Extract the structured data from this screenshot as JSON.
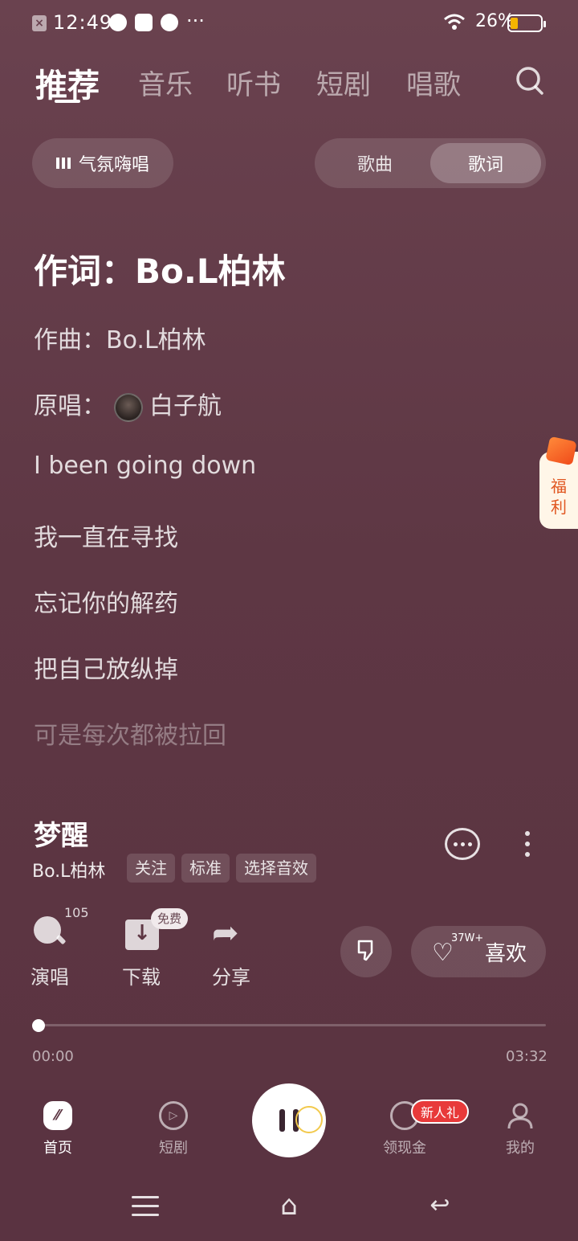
{
  "status_bar": {
    "time": "12:49",
    "dots": "···",
    "battery_percent": "26%",
    "battery_level": 0.26
  },
  "top_tabs": [
    {
      "label": "推荐",
      "active": true
    },
    {
      "label": "音乐",
      "active": false
    },
    {
      "label": "听书",
      "active": false
    },
    {
      "label": "短剧",
      "active": false
    },
    {
      "label": "唱歌",
      "active": false
    }
  ],
  "mode_button": "气氛嗨唱",
  "view_toggle": {
    "options": [
      "歌曲",
      "歌词"
    ],
    "selected": "歌词"
  },
  "lyrics": {
    "lyricist": "作词：Bo.L柏林",
    "composer": "作曲：Bo.L柏林",
    "original_prefix": "原唱：",
    "original_singer": "白子航",
    "lines": [
      "I been going down",
      "我一直在寻找",
      "忘记你的解药",
      "把自己放纵掉",
      "可是每次都被拉回"
    ]
  },
  "welfare_tab": "福利",
  "song": {
    "title": "梦醒",
    "artist": "Bo.L柏林",
    "chips": [
      "关注",
      "标准",
      "选择音效"
    ]
  },
  "actions": {
    "sing": {
      "label": "演唱",
      "count": "105"
    },
    "download": {
      "label": "下载",
      "badge": "免费"
    },
    "share": {
      "label": "分享"
    },
    "like": {
      "label": "喜欢",
      "count": "37W+"
    }
  },
  "progress": {
    "current": "00:00",
    "total": "03:32",
    "fraction": 0
  },
  "bottom_nav": {
    "items": [
      {
        "label": "首页",
        "active": true
      },
      {
        "label": "短剧",
        "active": false
      },
      {
        "label": "领现金",
        "active": false,
        "badge": "新人礼"
      },
      {
        "label": "我的",
        "active": false
      }
    ]
  }
}
